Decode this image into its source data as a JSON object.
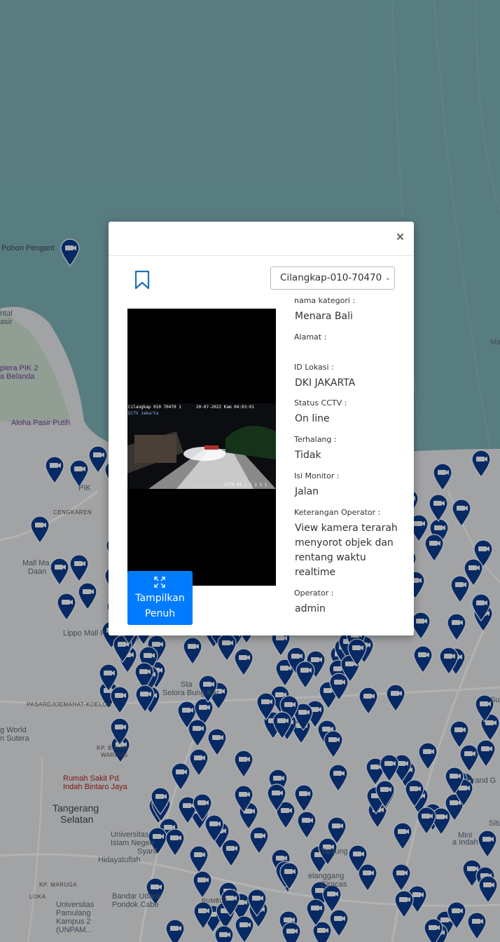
{
  "map": {
    "labels": [
      {
        "text": "Pohon Pengant",
        "cls": "dark"
      },
      {
        "text": "ntal",
        "cls": ""
      },
      {
        "text": "asir",
        "cls": ""
      },
      {
        "text": "piera PIK 2",
        "cls": "purple"
      },
      {
        "text": "a Belanda",
        "cls": "purple"
      },
      {
        "text": "Aloha Pasir Putih",
        "cls": "purple"
      },
      {
        "text": "PIK",
        "cls": ""
      },
      {
        "text": "CENGKAREN",
        "cls": "caps"
      },
      {
        "text": "Mall Ma",
        "cls": ""
      },
      {
        "text": "Daan",
        "cls": ""
      },
      {
        "text": "Lippo Mall P",
        "cls": ""
      },
      {
        "text": "PASARDJOEMAHAT-KOELON",
        "cls": "caps"
      },
      {
        "text": "g World",
        "cls": ""
      },
      {
        "text": "n Sutera",
        "cls": ""
      },
      {
        "text": "KP. BULAK",
        "cls": "caps"
      },
      {
        "text": "WARENG",
        "cls": "caps"
      },
      {
        "text": "Rumah Sakit Pd.",
        "cls": "red"
      },
      {
        "text": "Indah Bintaro Jaya",
        "cls": "red"
      },
      {
        "text": "Tangerang",
        "cls": "big"
      },
      {
        "text": "Selatan",
        "cls": "big"
      },
      {
        "text": "Universitas",
        "cls": ""
      },
      {
        "text": "Islam Negeri",
        "cls": ""
      },
      {
        "text": "Syarif",
        "cls": ""
      },
      {
        "text": "Hidayatullah",
        "cls": ""
      },
      {
        "text": "KP. MARUGA",
        "cls": "caps"
      },
      {
        "text": "LOKA",
        "cls": "caps"
      },
      {
        "text": "Bandar Udara",
        "cls": ""
      },
      {
        "text": "Pondok Cabe",
        "cls": ""
      },
      {
        "text": "RUMBUT",
        "cls": "caps"
      },
      {
        "text": "Universitas",
        "cls": ""
      },
      {
        "text": "Pamulang",
        "cls": ""
      },
      {
        "text": "Kampus 2",
        "cls": ""
      },
      {
        "text": "(UNPAM...",
        "cls": ""
      },
      {
        "text": "Sta",
        "cls": ""
      },
      {
        "text": "Selora Bung Kar",
        "cls": ""
      },
      {
        "text": "Grand G",
        "cls": ""
      },
      {
        "text": "Mini",
        "cls": ""
      },
      {
        "text": "a Indah",
        "cls": ""
      },
      {
        "text": "Situ",
        "cls": ""
      },
      {
        "text": "Su",
        "cls": ""
      },
      {
        "text": "Ma",
        "cls": ""
      },
      {
        "text": "Tanjung",
        "cls": ""
      },
      {
        "text": "elanggang",
        "cls": ""
      },
      {
        "text": "Ciracas",
        "cls": ""
      }
    ]
  },
  "modal": {
    "close_glyph": "×",
    "bookmark_icon": "bookmark-icon",
    "camera_select": {
      "selected": "Cilangkap-010-70470",
      "chevron": "⌄"
    },
    "video": {
      "osd_top_left": "Cilangkap 010 70470 1",
      "osd_top_right": "20-07-2022 Kam 04:03:01",
      "osd_sub": "ECTV Jakarta",
      "osd_bottom": "CCTV 01 1 1 1 1 1",
      "background": "#000000"
    },
    "fullscreen_button": {
      "label_line1": "Tampilkan",
      "label_line2": "Penuh",
      "icon": "expand-icon",
      "color": "#007bff"
    },
    "fields": [
      {
        "label": "nama kategori :",
        "value": "Menara Bali"
      },
      {
        "label": "Alamat :",
        "value": ""
      },
      {
        "label": "ID Lokasi :",
        "value": "DKI JAKARTA"
      },
      {
        "label": "Status CCTV :",
        "value": "On line"
      },
      {
        "label": "Terhalang :",
        "value": "Tidak"
      },
      {
        "label": "Isi Monitor :",
        "value": "Jalan"
      },
      {
        "label": "Keterangan Operator :",
        "value": "View kamera terarah menyorot objek dan rentang waktu realtime"
      },
      {
        "label": "Operator :",
        "value": "admin"
      }
    ]
  },
  "colors": {
    "pin": "#0b3d91",
    "sea": "#7fb3b8",
    "land": "#e8eaed",
    "button": "#007bff"
  }
}
